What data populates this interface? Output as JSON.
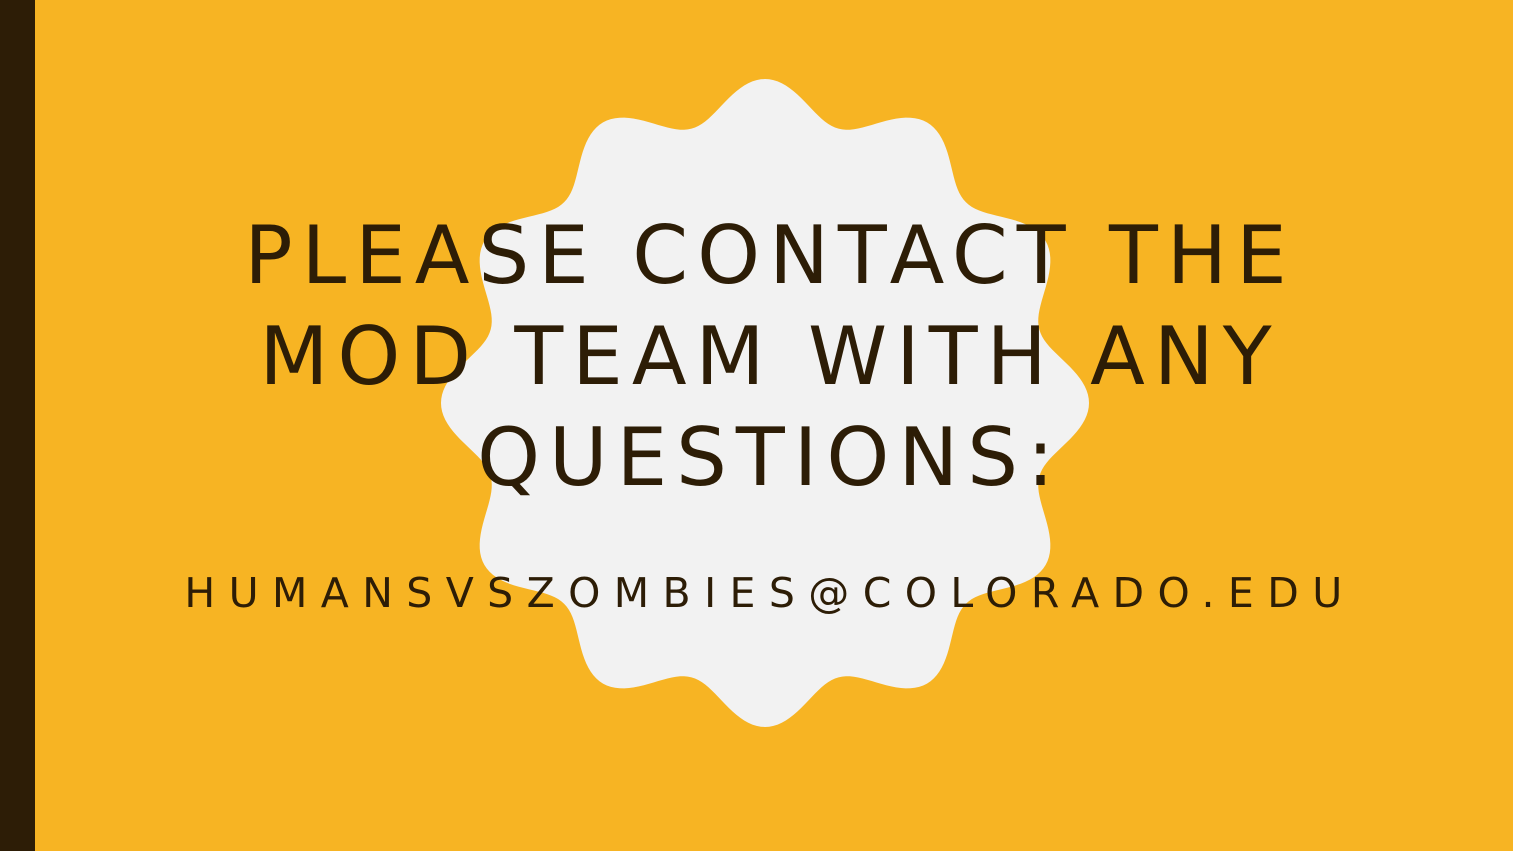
{
  "slide": {
    "title": "PLEASE CONTACT THE MOD TEAM WITH ANY QUESTIONS:",
    "email": "HUMANSVSZOMBIES@COLORADO.EDU"
  },
  "colors": {
    "background": "#F7B423",
    "accent_bar": "#2D1D06",
    "badge": "#F2F2F2",
    "text": "#2D1D06"
  },
  "icons": {
    "badge": "scalloped-badge-shape"
  }
}
